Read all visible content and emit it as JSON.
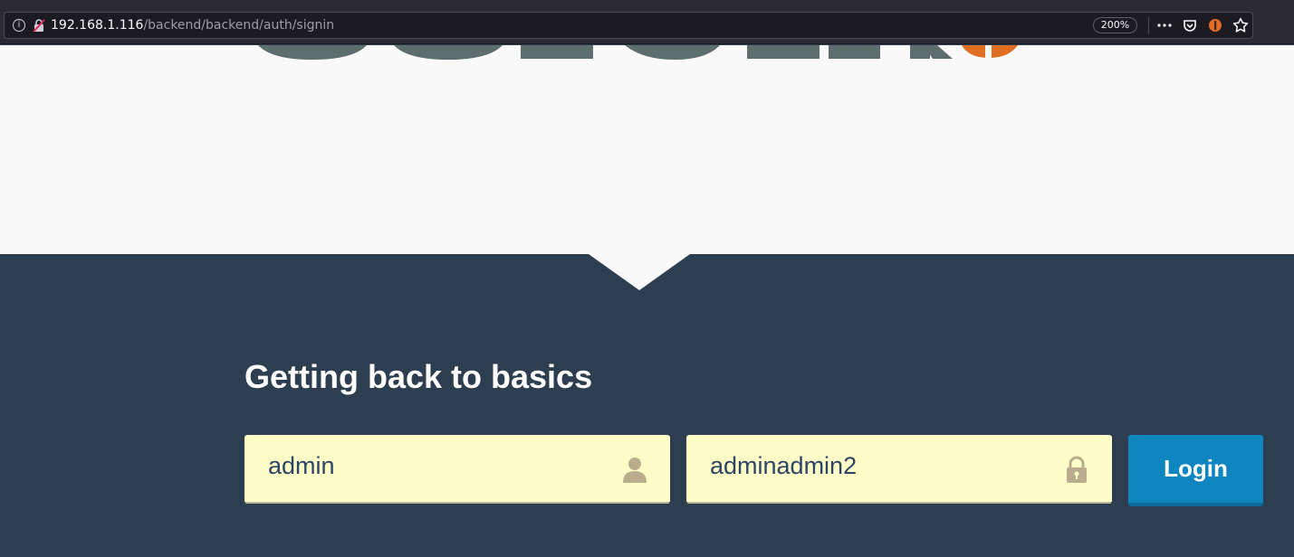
{
  "browser": {
    "url_host": "192.168.1.116",
    "url_path": "/backend/backend/auth/signin",
    "zoom": "200%",
    "icons": [
      "info-icon",
      "insecure-lock-icon",
      "more-icon",
      "pocket-icon",
      "extension-icon",
      "bookmark-star-icon"
    ]
  },
  "hero": {
    "logo_colors": {
      "letters": "#5e6d6d",
      "accent": "#e06f22"
    }
  },
  "login": {
    "tagline": "Getting back to basics",
    "username_value": "admin",
    "password_value": "adminadmin2",
    "login_label": "Login"
  },
  "colors": {
    "background": "#2d3e50",
    "input_bg": "#fefdc8",
    "button": "#0f86c0"
  }
}
